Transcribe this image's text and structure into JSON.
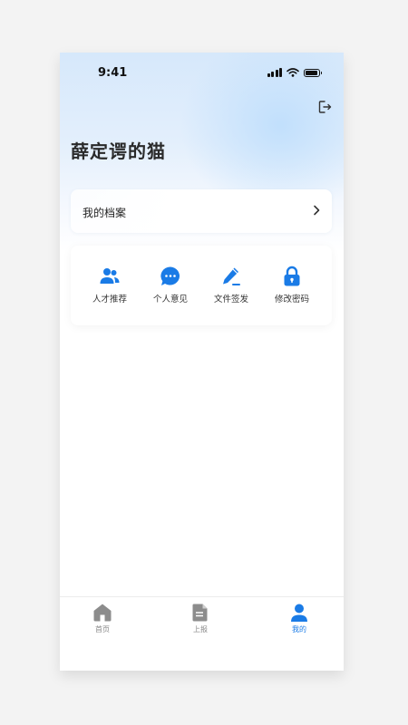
{
  "status_bar": {
    "time": "9:41"
  },
  "header": {
    "username": "薛定谔的猫"
  },
  "profile_card": {
    "label": "我的档案"
  },
  "actions": [
    {
      "label": "人才推荐",
      "icon": "users-icon"
    },
    {
      "label": "个人意见",
      "icon": "chat-bubble-icon"
    },
    {
      "label": "文件签发",
      "icon": "pen-sign-icon"
    },
    {
      "label": "修改密码",
      "icon": "lock-icon"
    }
  ],
  "tabbar": {
    "tabs": [
      {
        "label": "首页",
        "icon": "home-icon",
        "active": false
      },
      {
        "label": "上报",
        "icon": "document-icon",
        "active": false
      },
      {
        "label": "我的",
        "icon": "person-icon",
        "active": true
      }
    ]
  },
  "colors": {
    "accent": "#1a7be6",
    "inactive_icon": "#8c8c8c",
    "header_gradient_top": "#d6e8fb"
  }
}
